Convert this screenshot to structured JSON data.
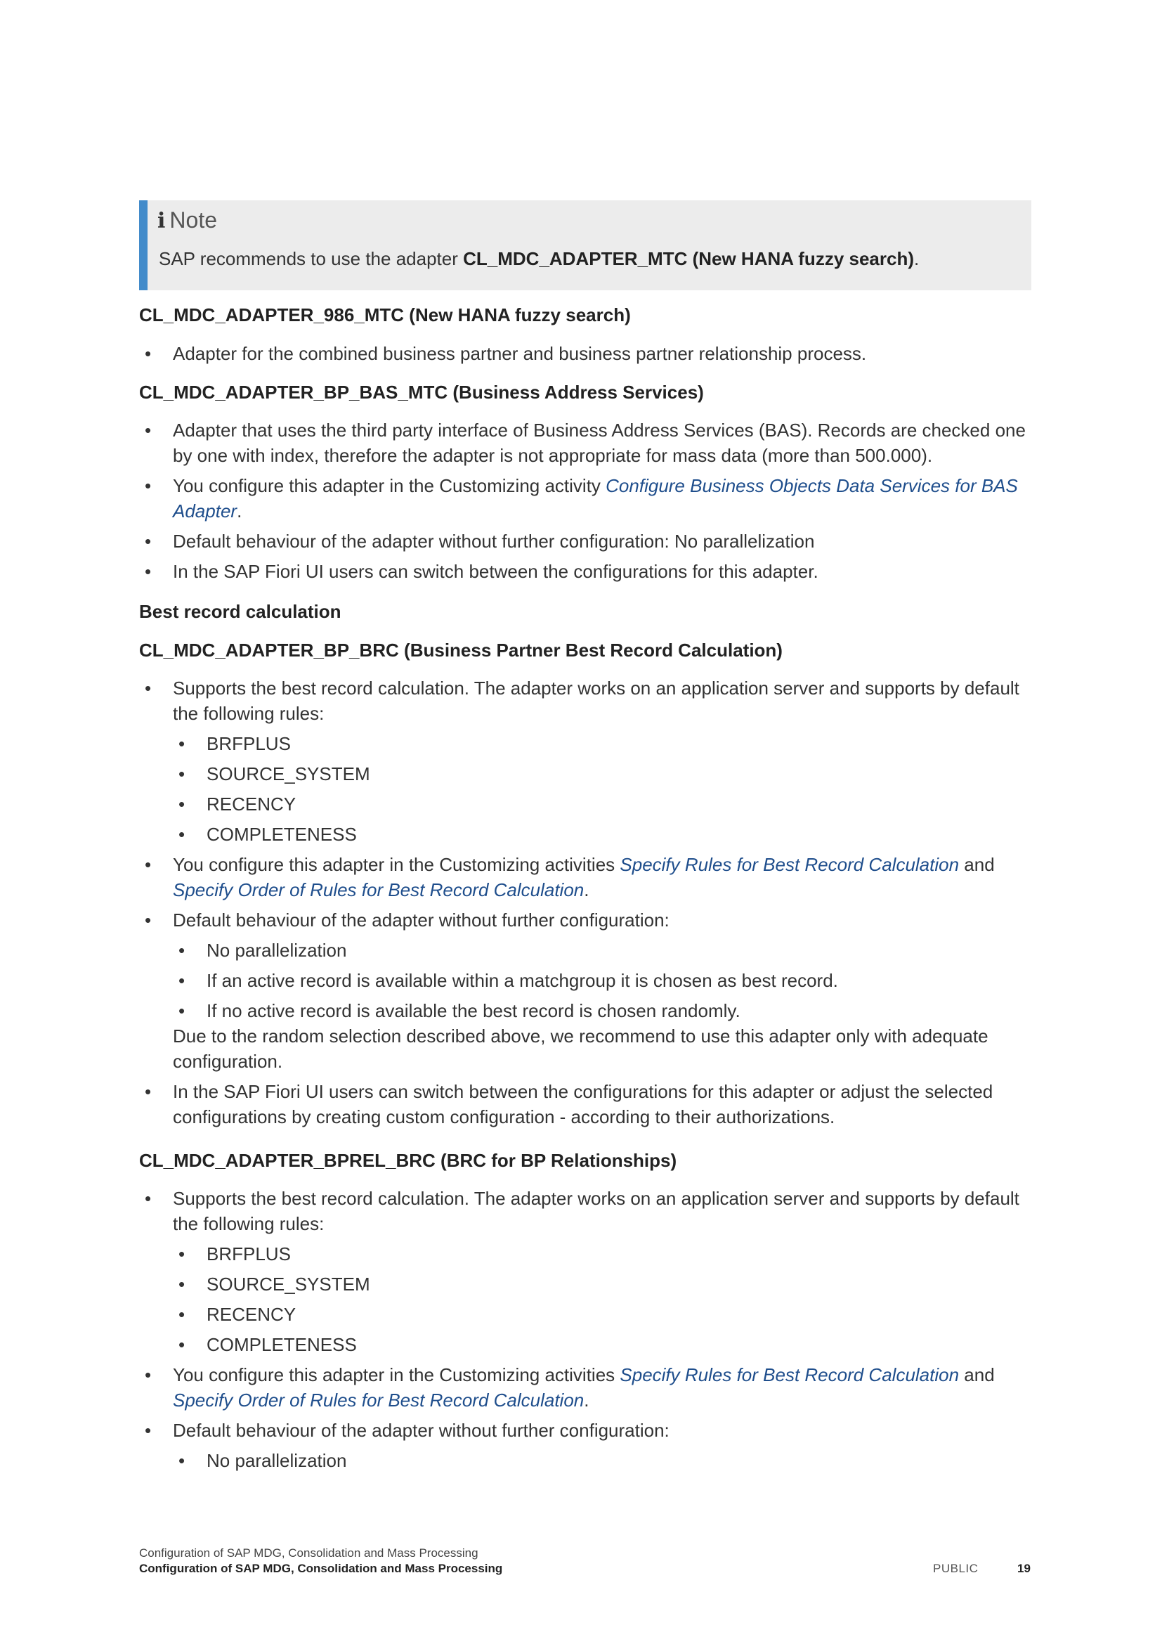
{
  "note": {
    "icon": "info-icon",
    "title": "Note",
    "text_pre": "SAP recommends to use the adapter ",
    "text_bold": "CL_MDC_ADAPTER_MTC (New HANA fuzzy search)",
    "text_post": "."
  },
  "s1": {
    "heading": "CL_MDC_ADAPTER_986_MTC (New HANA fuzzy search)",
    "b1": "Adapter for the combined business partner and business partner relationship process."
  },
  "s2": {
    "heading": "CL_MDC_ADAPTER_BP_BAS_MTC (Business Address Services)",
    "b1": "Adapter that uses the third party interface of Business Address Services (BAS). Records are checked one by one with index, therefore the adapter is not appropriate for mass data (more than 500.000).",
    "b2_pre": "You configure this adapter in the Customizing activity ",
    "b2_link": "Configure Business Objects Data Services for BAS Adapter",
    "b2_post": ".",
    "b3": "Default behaviour of the adapter without further configuration: No parallelization",
    "b4": "In the SAP Fiori UI users can switch between the configurations for this adapter."
  },
  "best_heading": "Best record calculation",
  "s3": {
    "heading": "CL_MDC_ADAPTER_BP_BRC (Business Partner Best Record Calculation)",
    "b1": "Supports the best record calculation. The adapter works on an application server and supports by default the following rules:",
    "rules": [
      "BRFPLUS",
      "SOURCE_SYSTEM",
      "RECENCY",
      "COMPLETENESS"
    ],
    "b2_pre": "You configure this adapter in the Customizing activities ",
    "b2_link1": "Specify Rules for Best Record Calculation",
    "b2_mid": " and ",
    "b2_link2": "Specify Order of Rules for Best Record Calculation",
    "b2_post": ".",
    "b3": "Default behaviour of the adapter without further configuration:",
    "defaults": [
      "No parallelization",
      "If an active record is available within a matchgroup it is chosen as best record.",
      "If no active record is available the best record is chosen randomly."
    ],
    "b3_cont": "Due to the random selection described above, we recommend to use this adapter only with adequate configuration.",
    "b4": "In the SAP Fiori UI users can switch between the configurations for this adapter or adjust the selected configurations by creating custom configuration - according to their authorizations."
  },
  "s4": {
    "heading": "CL_MDC_ADAPTER_BPREL_BRC (BRC for BP Relationships)",
    "b1": "Supports the best record calculation. The adapter works on an application server and supports by default the following rules:",
    "rules": [
      "BRFPLUS",
      "SOURCE_SYSTEM",
      "RECENCY",
      "COMPLETENESS"
    ],
    "b2_pre": "You configure this adapter in the Customizing activities ",
    "b2_link1": "Specify Rules for Best Record Calculation",
    "b2_mid": " and ",
    "b2_link2": "Specify Order of Rules for Best Record Calculation",
    "b2_post": ".",
    "b3": "Default behaviour of the adapter without further configuration:",
    "defaults": [
      "No parallelization"
    ]
  },
  "footer": {
    "line1": "Configuration of SAP MDG, Consolidation and Mass Processing",
    "line2": "Configuration of SAP MDG, Consolidation and Mass Processing",
    "public": "PUBLIC",
    "page": "19"
  }
}
